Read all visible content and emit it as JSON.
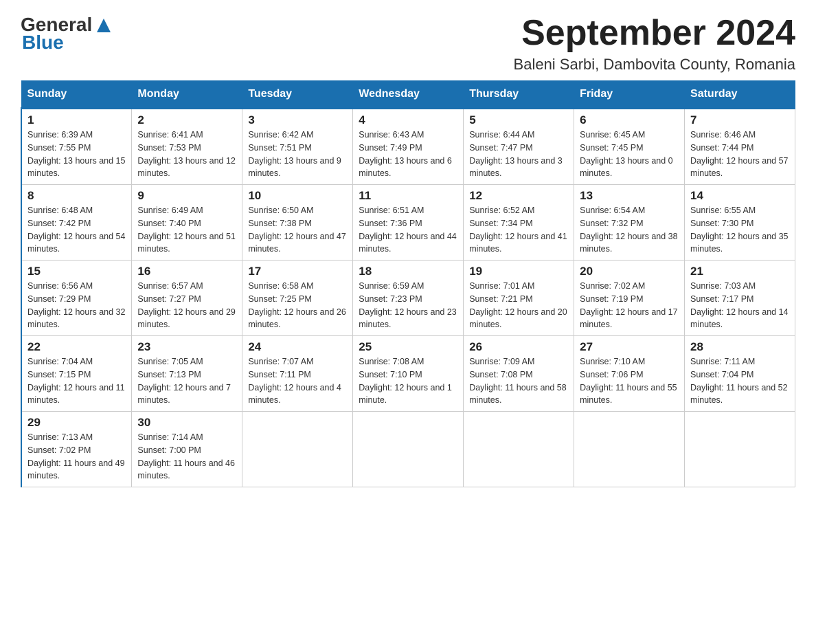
{
  "header": {
    "logo_general": "General",
    "logo_blue": "Blue",
    "month_title": "September 2024",
    "location": "Baleni Sarbi, Dambovita County, Romania"
  },
  "weekdays": [
    "Sunday",
    "Monday",
    "Tuesday",
    "Wednesday",
    "Thursday",
    "Friday",
    "Saturday"
  ],
  "weeks": [
    [
      {
        "day": "1",
        "sunrise": "6:39 AM",
        "sunset": "7:55 PM",
        "daylight": "13 hours and 15 minutes."
      },
      {
        "day": "2",
        "sunrise": "6:41 AM",
        "sunset": "7:53 PM",
        "daylight": "13 hours and 12 minutes."
      },
      {
        "day": "3",
        "sunrise": "6:42 AM",
        "sunset": "7:51 PM",
        "daylight": "13 hours and 9 minutes."
      },
      {
        "day": "4",
        "sunrise": "6:43 AM",
        "sunset": "7:49 PM",
        "daylight": "13 hours and 6 minutes."
      },
      {
        "day": "5",
        "sunrise": "6:44 AM",
        "sunset": "7:47 PM",
        "daylight": "13 hours and 3 minutes."
      },
      {
        "day": "6",
        "sunrise": "6:45 AM",
        "sunset": "7:45 PM",
        "daylight": "13 hours and 0 minutes."
      },
      {
        "day": "7",
        "sunrise": "6:46 AM",
        "sunset": "7:44 PM",
        "daylight": "12 hours and 57 minutes."
      }
    ],
    [
      {
        "day": "8",
        "sunrise": "6:48 AM",
        "sunset": "7:42 PM",
        "daylight": "12 hours and 54 minutes."
      },
      {
        "day": "9",
        "sunrise": "6:49 AM",
        "sunset": "7:40 PM",
        "daylight": "12 hours and 51 minutes."
      },
      {
        "day": "10",
        "sunrise": "6:50 AM",
        "sunset": "7:38 PM",
        "daylight": "12 hours and 47 minutes."
      },
      {
        "day": "11",
        "sunrise": "6:51 AM",
        "sunset": "7:36 PM",
        "daylight": "12 hours and 44 minutes."
      },
      {
        "day": "12",
        "sunrise": "6:52 AM",
        "sunset": "7:34 PM",
        "daylight": "12 hours and 41 minutes."
      },
      {
        "day": "13",
        "sunrise": "6:54 AM",
        "sunset": "7:32 PM",
        "daylight": "12 hours and 38 minutes."
      },
      {
        "day": "14",
        "sunrise": "6:55 AM",
        "sunset": "7:30 PM",
        "daylight": "12 hours and 35 minutes."
      }
    ],
    [
      {
        "day": "15",
        "sunrise": "6:56 AM",
        "sunset": "7:29 PM",
        "daylight": "12 hours and 32 minutes."
      },
      {
        "day": "16",
        "sunrise": "6:57 AM",
        "sunset": "7:27 PM",
        "daylight": "12 hours and 29 minutes."
      },
      {
        "day": "17",
        "sunrise": "6:58 AM",
        "sunset": "7:25 PM",
        "daylight": "12 hours and 26 minutes."
      },
      {
        "day": "18",
        "sunrise": "6:59 AM",
        "sunset": "7:23 PM",
        "daylight": "12 hours and 23 minutes."
      },
      {
        "day": "19",
        "sunrise": "7:01 AM",
        "sunset": "7:21 PM",
        "daylight": "12 hours and 20 minutes."
      },
      {
        "day": "20",
        "sunrise": "7:02 AM",
        "sunset": "7:19 PM",
        "daylight": "12 hours and 17 minutes."
      },
      {
        "day": "21",
        "sunrise": "7:03 AM",
        "sunset": "7:17 PM",
        "daylight": "12 hours and 14 minutes."
      }
    ],
    [
      {
        "day": "22",
        "sunrise": "7:04 AM",
        "sunset": "7:15 PM",
        "daylight": "12 hours and 11 minutes."
      },
      {
        "day": "23",
        "sunrise": "7:05 AM",
        "sunset": "7:13 PM",
        "daylight": "12 hours and 7 minutes."
      },
      {
        "day": "24",
        "sunrise": "7:07 AM",
        "sunset": "7:11 PM",
        "daylight": "12 hours and 4 minutes."
      },
      {
        "day": "25",
        "sunrise": "7:08 AM",
        "sunset": "7:10 PM",
        "daylight": "12 hours and 1 minute."
      },
      {
        "day": "26",
        "sunrise": "7:09 AM",
        "sunset": "7:08 PM",
        "daylight": "11 hours and 58 minutes."
      },
      {
        "day": "27",
        "sunrise": "7:10 AM",
        "sunset": "7:06 PM",
        "daylight": "11 hours and 55 minutes."
      },
      {
        "day": "28",
        "sunrise": "7:11 AM",
        "sunset": "7:04 PM",
        "daylight": "11 hours and 52 minutes."
      }
    ],
    [
      {
        "day": "29",
        "sunrise": "7:13 AM",
        "sunset": "7:02 PM",
        "daylight": "11 hours and 49 minutes."
      },
      {
        "day": "30",
        "sunrise": "7:14 AM",
        "sunset": "7:00 PM",
        "daylight": "11 hours and 46 minutes."
      },
      null,
      null,
      null,
      null,
      null
    ]
  ]
}
